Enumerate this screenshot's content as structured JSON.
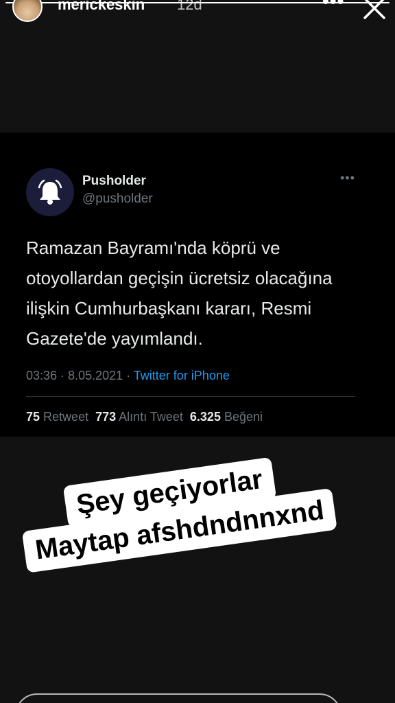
{
  "story": {
    "username": "merickeskin",
    "time_ago": "12d",
    "more_label": "•••",
    "progress": 1.0
  },
  "tweet": {
    "display_name": "Pusholder",
    "handle": "@pusholder",
    "more_label": "•••",
    "text": "Ramazan Bayramı'nda köprü ve otoyollardan geçişin ücretsiz olacağına ilişkin Cumhurbaşkanı kararı, Resmi Gazete'de yayımlandı.",
    "time": "03:36 · 8.05.2021 · ",
    "source": "Twitter for iPhone",
    "stats": {
      "retweets": "75",
      "retweets_label": "Retweet",
      "quotes": "773",
      "quotes_label": "Alıntı Tweet",
      "likes": "6.325",
      "likes_label": "Beğeni"
    }
  },
  "caption": {
    "line1": "Şey geçiyorlar",
    "line2": "Maytap afshdndnnxnd"
  },
  "icons": {
    "avatar": "profile-avatar",
    "close": "close-icon",
    "more": "more-icon",
    "bell": "bell-icon"
  },
  "colors": {
    "link": "#1d9bf0",
    "tweet_bg": "#000000",
    "story_bg": "#121212"
  }
}
